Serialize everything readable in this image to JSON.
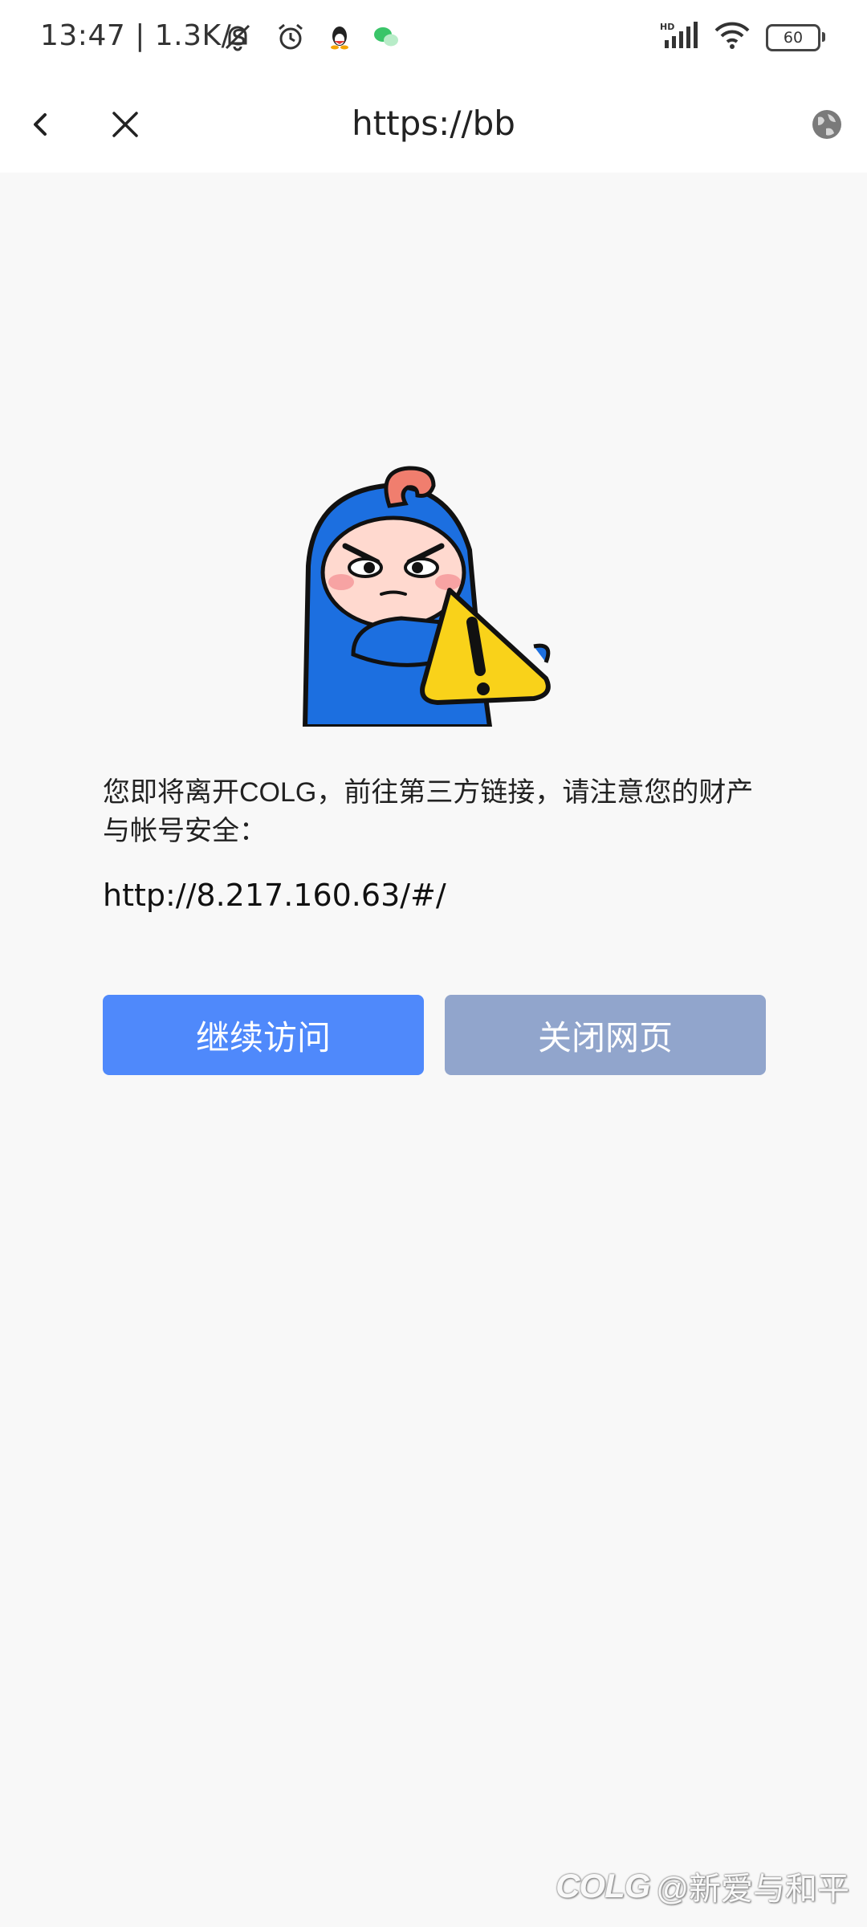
{
  "status_bar": {
    "time": "13:47 | 1.3K/s",
    "battery": "60",
    "icons": [
      "mute-icon",
      "alarm-icon",
      "qq-icon",
      "wechat-icon",
      "hd-signal-icon",
      "wifi-icon",
      "battery-icon"
    ]
  },
  "nav": {
    "title": "https://bb",
    "icons": [
      "back-icon",
      "close-icon",
      "globe-icon"
    ]
  },
  "warning": {
    "message": "您即将离开COLG，前往第三方链接，请注意您的财产与帐号安全：",
    "url": "http://8.217.160.63/#/",
    "continue_label": "继续访问",
    "close_label": "关闭网页"
  },
  "watermark": {
    "logo": "COLG",
    "text": "@新爱与和平"
  },
  "colors": {
    "primary_button": "#4f89fb",
    "secondary_button": "#91a5cc",
    "background": "#f8f8f8",
    "mascot_blue": "#1c6fe0",
    "warning_yellow": "#f9d21a"
  }
}
